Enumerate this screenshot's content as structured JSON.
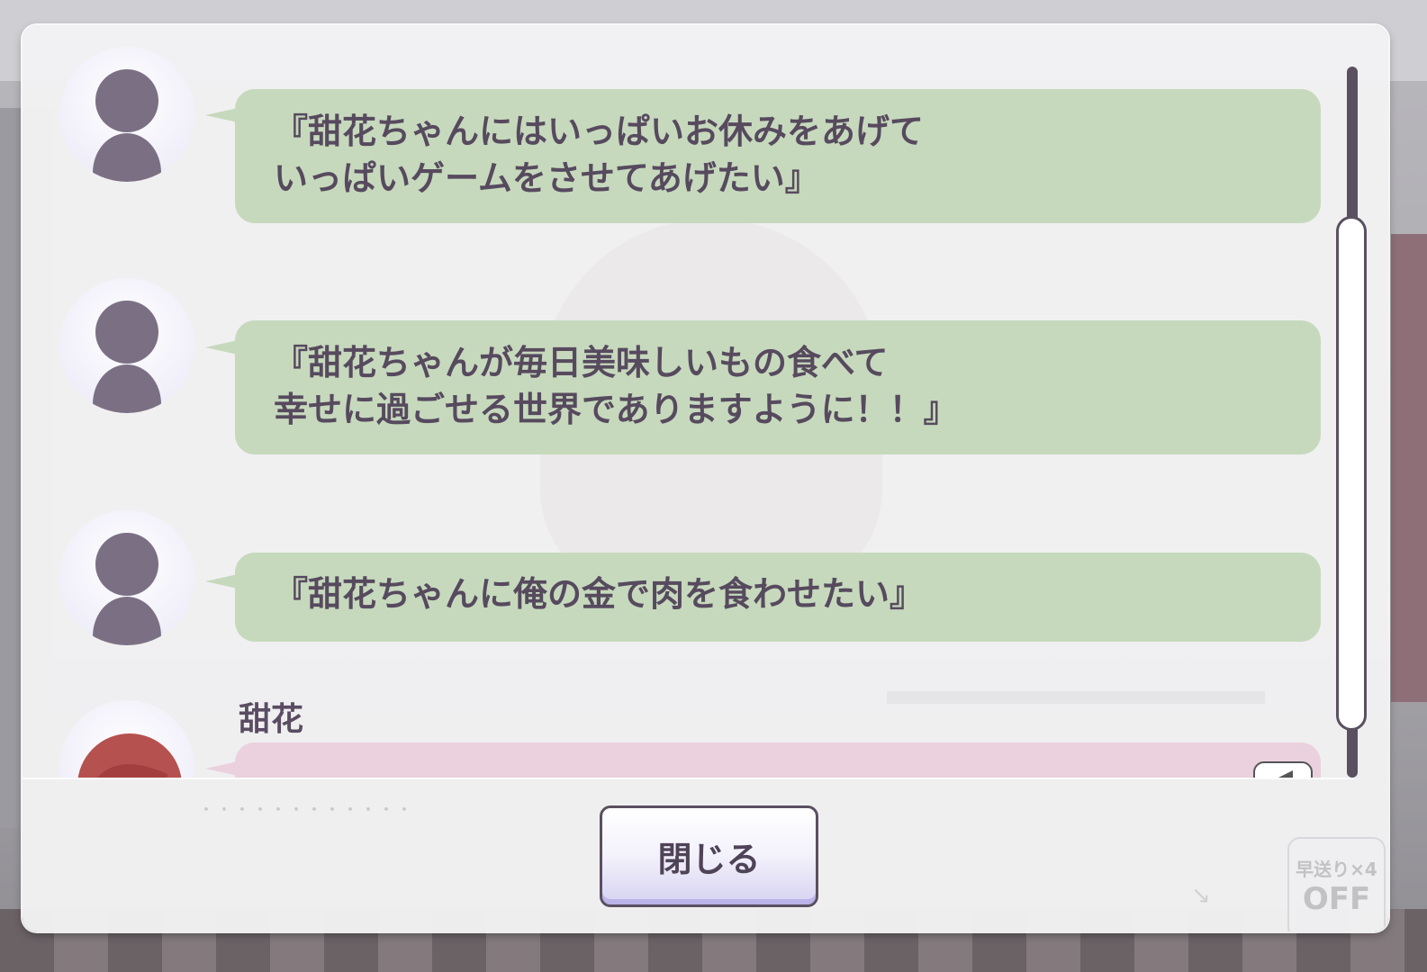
{
  "log": {
    "entries": [
      {
        "speaker": "",
        "avatar": "silhouette-icon",
        "style": "green",
        "text": "『甜花ちゃんにはいっぱいお休みをあげて\nいっぱいゲームをさせてあげたい』"
      },
      {
        "speaker": "",
        "avatar": "silhouette-icon",
        "style": "green",
        "text": "『甜花ちゃんが毎日美味しいもの食べて\n幸せに過ごせる世界でありますように！！』"
      },
      {
        "speaker": "",
        "avatar": "silhouette-icon",
        "style": "green",
        "text": "『甜花ちゃんに俺の金で肉を食わせたい』"
      },
      {
        "speaker": "甜花",
        "avatar": "character-portrait",
        "style": "pink",
        "text": "",
        "has_voice": true
      }
    ]
  },
  "dots": "・・・・・・・・・・・・",
  "close_button": {
    "label": "閉じる"
  },
  "background": {
    "fast_forward_label": "早送り×4",
    "fast_forward_state": "OFF"
  },
  "colors": {
    "green_bubble": "#c6d9bd",
    "pink_bubble": "#ead1dd",
    "text": "#574a5e",
    "accent": "#5a5060"
  }
}
